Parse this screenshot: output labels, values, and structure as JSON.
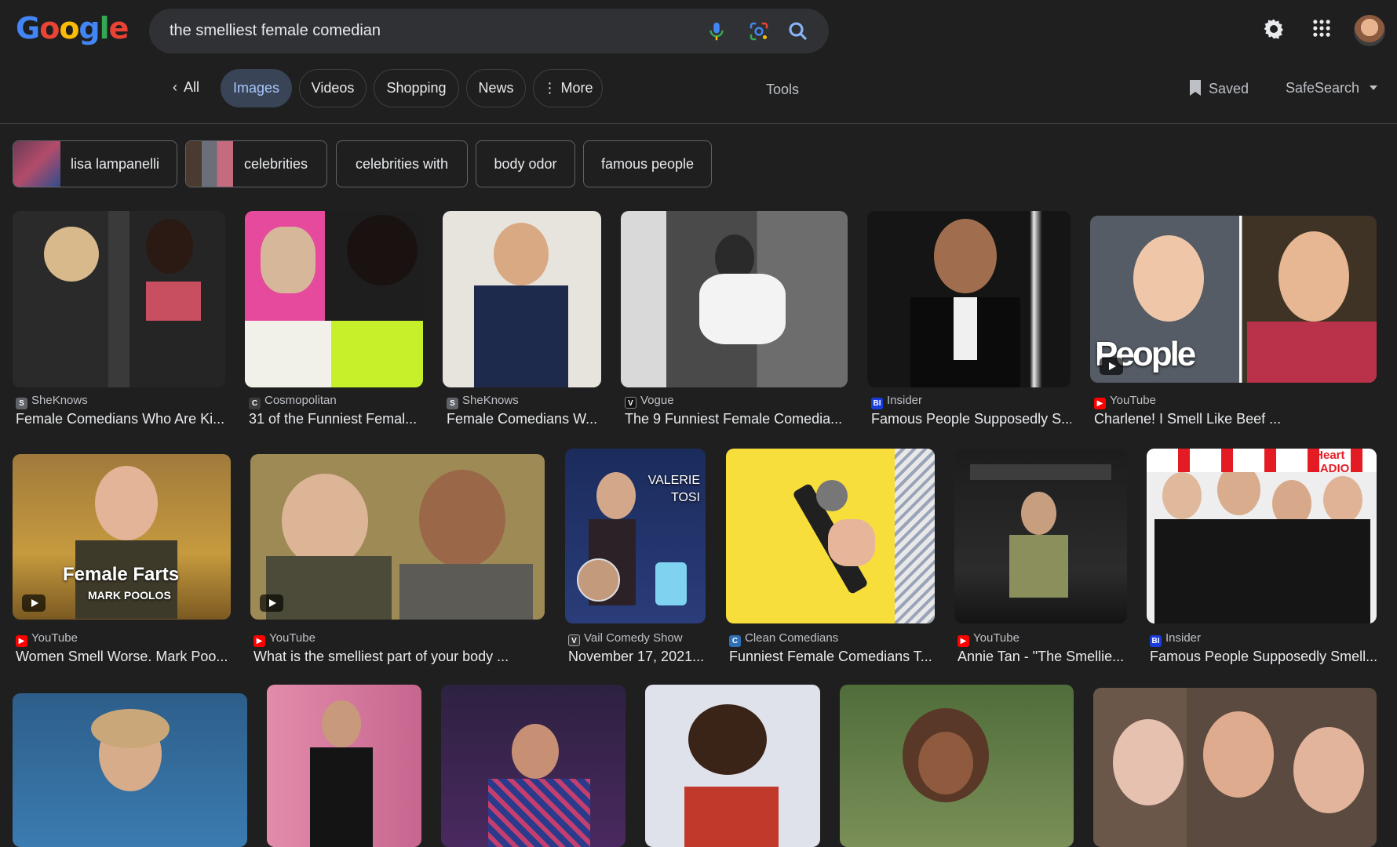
{
  "logo": {
    "letters": [
      "G",
      "o",
      "o",
      "g",
      "l",
      "e"
    ]
  },
  "search": {
    "query": "the smelliest female comedian"
  },
  "tabs": {
    "back_all": "All",
    "images": "Images",
    "videos": "Videos",
    "shopping": "Shopping",
    "news": "News",
    "more": "More",
    "tools": "Tools",
    "saved": "Saved",
    "safesearch": "SafeSearch"
  },
  "chips": [
    {
      "label": "lisa lampanelli"
    },
    {
      "label": "celebrities"
    },
    {
      "label": "celebrities with"
    },
    {
      "label": "body odor"
    },
    {
      "label": "famous people"
    }
  ],
  "results_row1": [
    {
      "source": "SheKnows",
      "title": "Female Comedians Who Are Ki...",
      "favicon_color": "#5f6368"
    },
    {
      "source": "Cosmopolitan",
      "title": "31 of the Funniest Femal...",
      "favicon_color": "#3c3c3c"
    },
    {
      "source": "SheKnows",
      "title": "Female Comedians W...",
      "favicon_color": "#5f6368"
    },
    {
      "source": "Vogue",
      "title": "The 9 Funniest Female Comedia...",
      "favicon_color": "#111111"
    },
    {
      "source": "Insider",
      "title": "Famous People Supposedly S...",
      "favicon_color": "#1a3cdb"
    },
    {
      "source": "YouTube",
      "title": "Charlene! I Smell Like Beef ...",
      "favicon_color": "#ff0000"
    }
  ],
  "results_row2": [
    {
      "source": "YouTube",
      "title": "Women Smell Worse. Mark Poo...",
      "favicon_color": "#ff0000",
      "overlay_title": "Female Farts",
      "overlay_sub": "MARK POOLOS"
    },
    {
      "source": "YouTube",
      "title": "What is the smelliest part of your body ...",
      "favicon_color": "#ff0000"
    },
    {
      "source": "Vail Comedy Show",
      "title": "November 17, 2021...",
      "favicon_color": "#333333",
      "overlay_name": "VALERIE TOSI"
    },
    {
      "source": "Clean Comedians",
      "title": "Funniest Female Comedians T...",
      "favicon_color": "#2f6fb3"
    },
    {
      "source": "YouTube",
      "title": "Annie Tan - \"The Smellie...",
      "favicon_color": "#ff0000"
    },
    {
      "source": "Insider",
      "title": "Famous People Supposedly Smell...",
      "favicon_color": "#1a3cdb",
      "overlay_brand": "iHeart RADIO"
    }
  ],
  "overlay_people": "People"
}
